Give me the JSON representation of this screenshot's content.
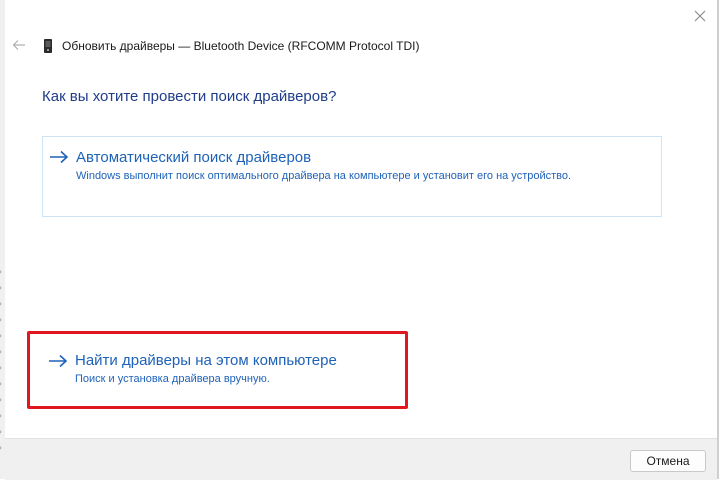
{
  "window": {
    "title": "Обновить драйверы — Bluetooth Device (RFCOMM Protocol TDI)",
    "title_icon": "bluetooth-device-icon",
    "back_icon": "back-arrow-icon",
    "close_icon": "close-icon"
  },
  "main": {
    "question": "Как вы хотите провести поиск драйверов?",
    "options": [
      {
        "title": "Автоматический поиск драйверов",
        "description": "Windows выполнит поиск оптимального драйвера на компьютере и установит его на устройство.",
        "icon": "arrow-right-icon"
      },
      {
        "title": "Найти драйверы на этом компьютере",
        "description": "Поиск и установка драйвера вручную.",
        "icon": "arrow-right-icon",
        "highlighted": true
      }
    ]
  },
  "footer": {
    "cancel_label": "Отмена"
  },
  "colors": {
    "accent": "#1e62b8",
    "heading": "#1f3d8a",
    "highlight_border": "#e0171f",
    "footer_bg": "#f0f0f0",
    "option_border": "#cfe3f2"
  }
}
